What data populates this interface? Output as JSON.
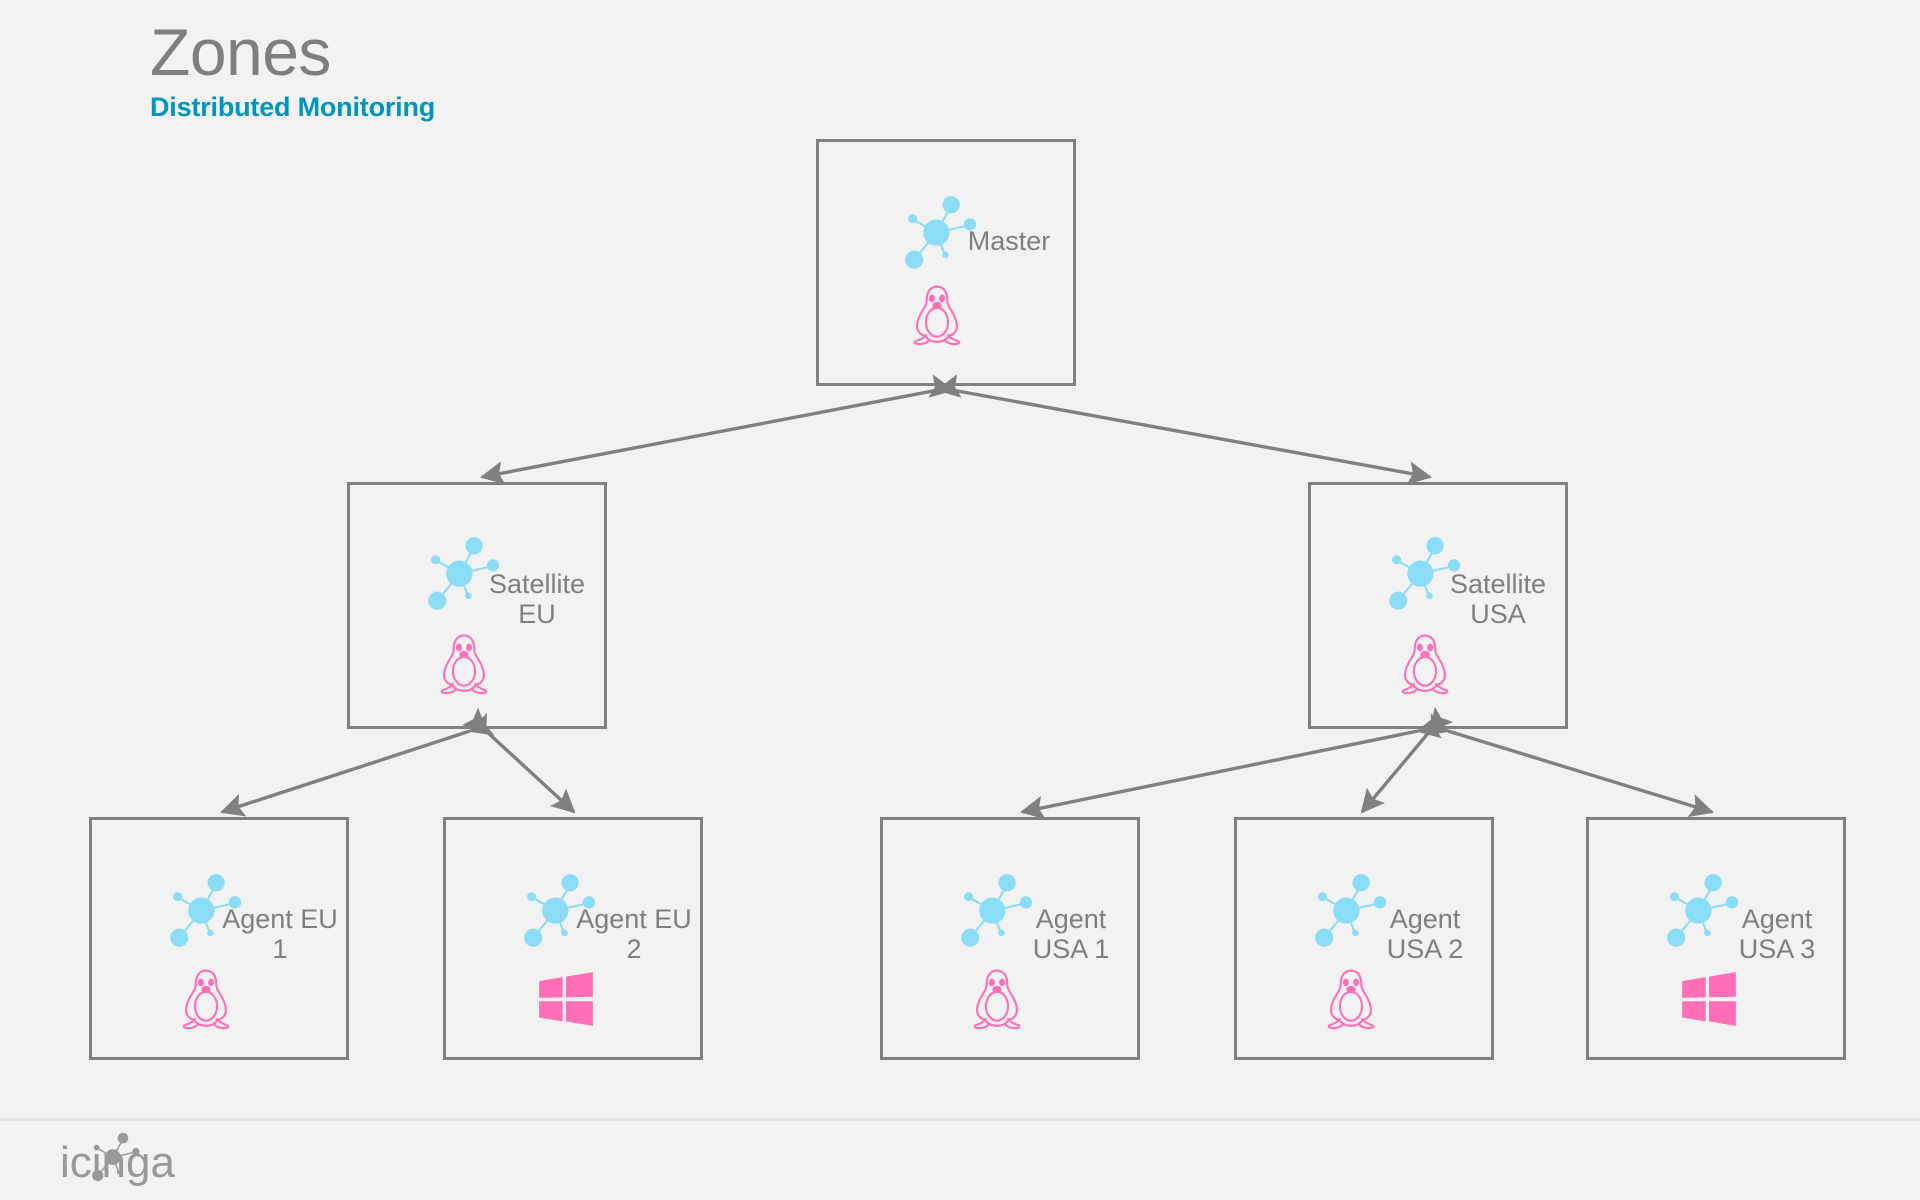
{
  "page": {
    "background_color": "#f2f2f2",
    "title": "Zones",
    "subtitle": "Distributed Monitoring",
    "title_color": "#7f7f7f",
    "subtitle_color": "#0095bf"
  },
  "theme": {
    "box_border_color": "#808080",
    "label_color": "#7f7f7f",
    "icinga_node_color": "#8bdcf7",
    "os_icon_color": "#ff6fb5",
    "arrow_color": "#808080",
    "footer_rule_color": "#e2e2e2",
    "footer_logo_color": "#999999"
  },
  "diagram": {
    "type": "hierarchy",
    "nodes": [
      {
        "id": "master",
        "role": "Master",
        "label": "Master",
        "label_line1": "Master",
        "label_line2": "",
        "os": "linux",
        "os_icon": "tux-penguin-icon",
        "icinga_icon": "icinga-node-graph-icon",
        "tier": 1
      },
      {
        "id": "satellite-eu",
        "role": "Satellite",
        "label": "Satellite EU",
        "label_line1": "Satellite",
        "label_line2": "EU",
        "os": "linux",
        "os_icon": "tux-penguin-icon",
        "icinga_icon": "icinga-node-graph-icon",
        "tier": 2
      },
      {
        "id": "satellite-usa",
        "role": "Satellite",
        "label": "Satellite USA",
        "label_line1": "Satellite",
        "label_line2": "USA",
        "os": "linux",
        "os_icon": "tux-penguin-icon",
        "icinga_icon": "icinga-node-graph-icon",
        "tier": 2
      },
      {
        "id": "agent-eu-1",
        "role": "Agent",
        "label": "Agent EU 1",
        "label_line1": "Agent",
        "label_line2": "EU 1",
        "os": "linux",
        "os_icon": "tux-penguin-icon",
        "icinga_icon": "icinga-node-graph-icon",
        "tier": 3
      },
      {
        "id": "agent-eu-2",
        "role": "Agent",
        "label": "Agent EU 2",
        "label_line1": "Agent",
        "label_line2": "EU 2",
        "os": "windows",
        "os_icon": "windows-logo-icon",
        "icinga_icon": "icinga-node-graph-icon",
        "tier": 3
      },
      {
        "id": "agent-usa-1",
        "role": "Agent",
        "label": "Agent USA 1",
        "label_line1": "Agent",
        "label_line2": "USA 1",
        "os": "linux",
        "os_icon": "tux-penguin-icon",
        "icinga_icon": "icinga-node-graph-icon",
        "tier": 3
      },
      {
        "id": "agent-usa-2",
        "role": "Agent",
        "label": "Agent USA 2",
        "label_line1": "Agent",
        "label_line2": "USA 2",
        "os": "linux",
        "os_icon": "tux-penguin-icon",
        "icinga_icon": "icinga-node-graph-icon",
        "tier": 3
      },
      {
        "id": "agent-usa-3",
        "role": "Agent",
        "label": "Agent USA 3",
        "label_line1": "Agent",
        "label_line2": "USA 3",
        "os": "windows",
        "os_icon": "windows-logo-icon",
        "icinga_icon": "icinga-node-graph-icon",
        "tier": 3
      }
    ],
    "edges": [
      {
        "from": "master",
        "to": "satellite-eu",
        "style": "double-headed-arrow"
      },
      {
        "from": "master",
        "to": "satellite-usa",
        "style": "double-headed-arrow"
      },
      {
        "from": "satellite-eu",
        "to": "agent-eu-1",
        "style": "double-headed-arrow"
      },
      {
        "from": "satellite-eu",
        "to": "agent-eu-2",
        "style": "double-headed-arrow"
      },
      {
        "from": "satellite-usa",
        "to": "agent-usa-1",
        "style": "double-headed-arrow"
      },
      {
        "from": "satellite-usa",
        "to": "agent-usa-2",
        "style": "double-headed-arrow"
      },
      {
        "from": "satellite-usa",
        "to": "agent-usa-3",
        "style": "double-headed-arrow"
      }
    ]
  },
  "footer": {
    "brand": "icinga",
    "logo_icon": "icinga-node-graph-icon"
  }
}
